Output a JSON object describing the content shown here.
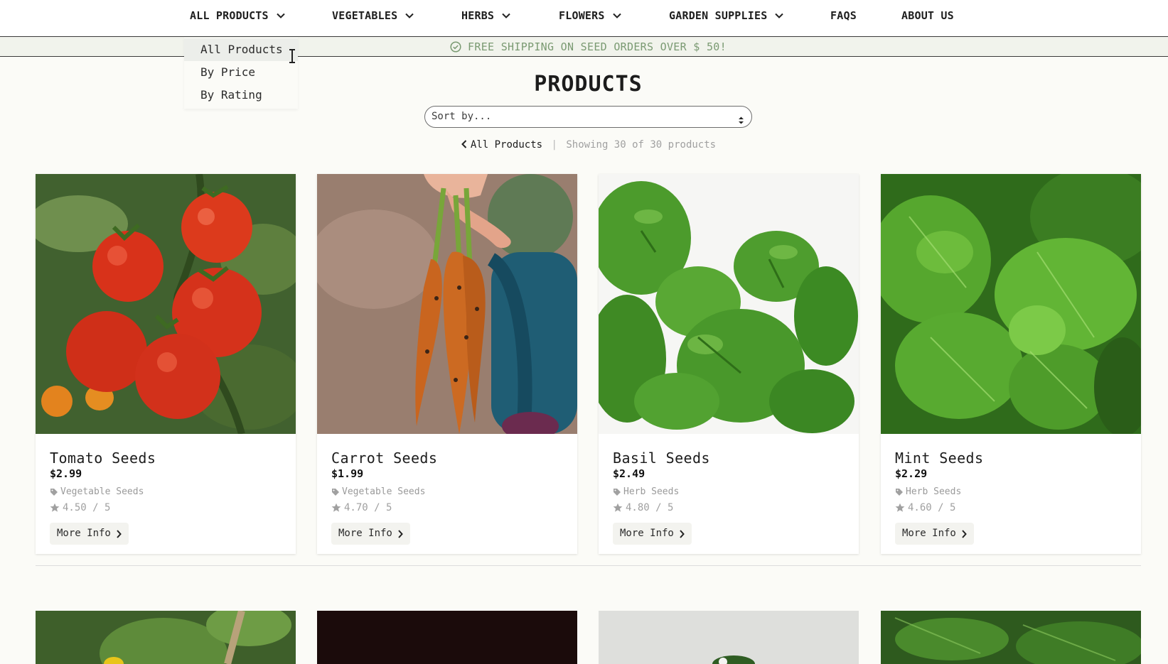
{
  "nav": {
    "items": [
      {
        "label": "ALL PRODUCTS",
        "has_dropdown": true
      },
      {
        "label": "VEGETABLES",
        "has_dropdown": true
      },
      {
        "label": "HERBS",
        "has_dropdown": true
      },
      {
        "label": "FLOWERS",
        "has_dropdown": true
      },
      {
        "label": "GARDEN SUPPLIES",
        "has_dropdown": true
      },
      {
        "label": "FAQS",
        "has_dropdown": false
      },
      {
        "label": "ABOUT US",
        "has_dropdown": false
      }
    ]
  },
  "dropdown": {
    "items": [
      "All Products",
      "By Price",
      "By Rating"
    ],
    "active": "All Products"
  },
  "banner": {
    "text": "FREE SHIPPING ON SEED ORDERS OVER $ 50!",
    "icon": "check-circle-icon"
  },
  "page": {
    "title": "PRODUCTS",
    "sort_placeholder": "Sort by...",
    "back_label": "All Products",
    "count_text": "Showing 30 of 30 products"
  },
  "products": [
    {
      "name": "Tomato Seeds",
      "price": "$2.99",
      "category": "Vegetable Seeds",
      "rating": "4.50 / 5",
      "more": "More Info"
    },
    {
      "name": "Carrot Seeds",
      "price": "$1.99",
      "category": "Vegetable Seeds",
      "rating": "4.70 / 5",
      "more": "More Info"
    },
    {
      "name": "Basil Seeds",
      "price": "$2.49",
      "category": "Herb Seeds",
      "rating": "4.80 / 5",
      "more": "More Info"
    },
    {
      "name": "Mint Seeds",
      "price": "$2.29",
      "category": "Herb Seeds",
      "rating": "4.60 / 5",
      "more": "More Info"
    }
  ],
  "colors": {
    "banner_text": "#7a9a72",
    "banner_bg": "#f1f3ec",
    "page_bg": "#fbfbf7"
  }
}
